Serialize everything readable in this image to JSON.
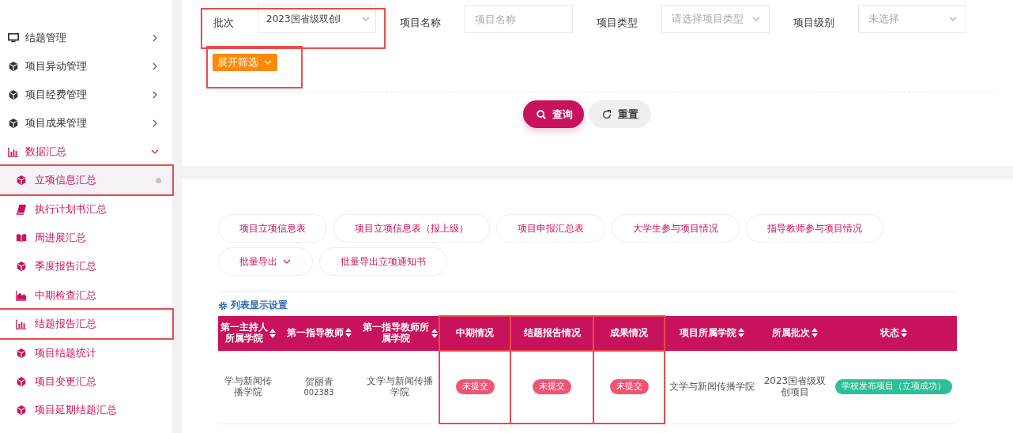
{
  "sidebar": {
    "items": [
      {
        "label": "结题管理",
        "kind": "monitor",
        "expanded": false
      },
      {
        "label": "项目异动管理",
        "kind": "cube",
        "expanded": false
      },
      {
        "label": "项目经费管理",
        "kind": "cube",
        "expanded": false
      },
      {
        "label": "项目成果管理",
        "kind": "cube",
        "expanded": false
      },
      {
        "label": "数据汇总",
        "kind": "bars",
        "expanded": true,
        "children": [
          {
            "label": "立项信息汇总",
            "kind": "cube",
            "selected": true,
            "highlighted": true
          },
          {
            "label": "执行计划书汇总",
            "kind": "book",
            "selected": false,
            "highlighted": false
          },
          {
            "label": "周进展汇总",
            "kind": "open-book",
            "selected": false,
            "highlighted": false
          },
          {
            "label": "季度报告汇总",
            "kind": "cube",
            "selected": false,
            "highlighted": false
          },
          {
            "label": "中期检查汇总",
            "kind": "area",
            "selected": false,
            "highlighted": false
          },
          {
            "label": "结题报告汇总",
            "kind": "bars",
            "selected": false,
            "highlighted": true
          },
          {
            "label": "项目结题统计",
            "kind": "cube",
            "selected": false,
            "highlighted": false
          },
          {
            "label": "项目变更汇总",
            "kind": "cube",
            "selected": false,
            "highlighted": false
          },
          {
            "label": "项目延期结题汇总",
            "kind": "cube",
            "selected": false,
            "highlighted": false
          }
        ]
      }
    ]
  },
  "filters": [
    {
      "label": "批次",
      "kind": "select",
      "value": "2023国省级双创I",
      "highlighted": true
    },
    {
      "label": "项目名称",
      "kind": "input",
      "placeholder": "项目名称",
      "highlighted": false
    },
    {
      "label": "项目类型",
      "kind": "select",
      "placeholder": "请选择项目类型",
      "highlighted": false
    },
    {
      "label": "项目级别",
      "kind": "select",
      "placeholder": "未选择",
      "highlighted": false
    }
  ],
  "expand_button": {
    "label": "展开筛选",
    "highlighted": true
  },
  "search_buttons": [
    {
      "label": "查询",
      "kind": "primary"
    },
    {
      "label": "重置",
      "kind": "reset"
    }
  ],
  "export_buttons": [
    {
      "label": "项目立项信息表",
      "dropdown": false
    },
    {
      "label": "项目立项信息表（报上级）",
      "dropdown": false
    },
    {
      "label": "项目申报汇总表",
      "dropdown": false
    },
    {
      "label": "大学生参与项目情况",
      "dropdown": false
    },
    {
      "label": "指导教师参与项目情况",
      "dropdown": false
    },
    {
      "label": "批量导出",
      "dropdown": true
    },
    {
      "label": "批量导出立项通知书",
      "dropdown": false
    }
  ],
  "list_settings": "列表显示设置",
  "table": {
    "columns": [
      {
        "label": "第一主持人所属学院",
        "sortable": true,
        "highlighted": false
      },
      {
        "label": "第一指导教师",
        "sortable": true,
        "highlighted": false
      },
      {
        "label": "第一指导教师所属学院",
        "sortable": true,
        "highlighted": false
      },
      {
        "label": "中期情况",
        "sortable": false,
        "highlighted": true
      },
      {
        "label": "结题报告情况",
        "sortable": false,
        "highlighted": true
      },
      {
        "label": "成果情况",
        "sortable": false,
        "highlighted": true
      },
      {
        "label": "项目所属学院",
        "sortable": true,
        "highlighted": false
      },
      {
        "label": "所属批次",
        "sortable": true,
        "highlighted": false
      },
      {
        "label": "状态",
        "sortable": true,
        "highlighted": false
      }
    ],
    "rows": [
      {
        "cells": [
          {
            "kind": "text",
            "text": "学与新闻传播学院"
          },
          {
            "kind": "person",
            "text": "贺丽青",
            "sub": "002383"
          },
          {
            "kind": "text",
            "text": "文学与新闻传播学院"
          },
          {
            "kind": "badge",
            "text": "未提交",
            "color": "#ef5472"
          },
          {
            "kind": "badge",
            "text": "未提交",
            "color": "#ef5472"
          },
          {
            "kind": "badge",
            "text": "未提交",
            "color": "#ef5472"
          },
          {
            "kind": "text",
            "text": "文学与新闻传播学院"
          },
          {
            "kind": "text",
            "text": "2023国省级双创项目"
          },
          {
            "kind": "badge",
            "text": "学校发布项目（立项成功）",
            "color": "#2cbf97"
          }
        ]
      }
    ]
  }
}
